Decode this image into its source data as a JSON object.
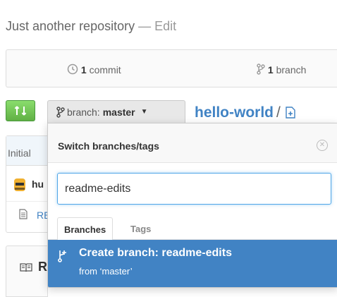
{
  "repo": {
    "description": "Just another repository",
    "separator": "—",
    "edit_label": "Edit",
    "name": "hello-world",
    "path_separator": "/"
  },
  "summary": {
    "commits_count": "1",
    "commits_label": "commit",
    "branches_count": "1",
    "branches_label": "branch"
  },
  "branch_select": {
    "prefix": "branch:",
    "current": "master"
  },
  "background": {
    "commit_message": "Initial",
    "author": "hu",
    "file_name": "RE",
    "readme_label": "R"
  },
  "branch_dropdown": {
    "title": "Switch branches/tags",
    "filter_value": "readme-edits",
    "tabs": [
      "Branches",
      "Tags"
    ],
    "create_title": "Create branch: readme-edits",
    "create_from": "from ‘master’"
  },
  "colors": {
    "accent": "#4183c4",
    "compare_green": "#60b044",
    "focus_border": "#51a7e8"
  },
  "icons": [
    "history-icon",
    "branch-icon",
    "compare-icon",
    "add-file-icon",
    "close-icon",
    "file-icon",
    "book-icon"
  ]
}
